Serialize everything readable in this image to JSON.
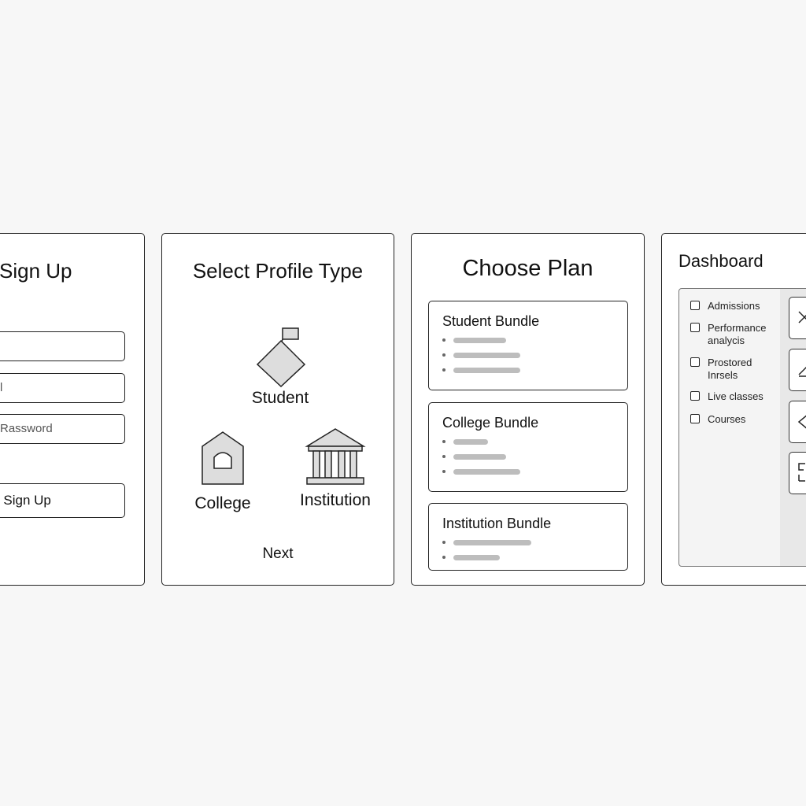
{
  "signup": {
    "title": "Sign Up",
    "fields": [
      "",
      "l",
      "Rassword"
    ],
    "button_label": "r Sign Up"
  },
  "profile": {
    "title": "Select Profile Type",
    "options": [
      "Student",
      "College",
      "Institution"
    ],
    "next_label": "Next"
  },
  "plan": {
    "title": "Choose Plan",
    "bundles": [
      "Student Bundle",
      "College Bundle",
      "Institution Bundle"
    ]
  },
  "dashboard": {
    "title": "Dashboard",
    "nav": [
      "Admissions",
      "Performance analycis",
      "Prostored Inrsels",
      "Live classes",
      "Courses"
    ]
  },
  "colors": {
    "border": "#222222",
    "placeholder_bar": "#bdbdbd",
    "panel": "#f4f4f4"
  }
}
